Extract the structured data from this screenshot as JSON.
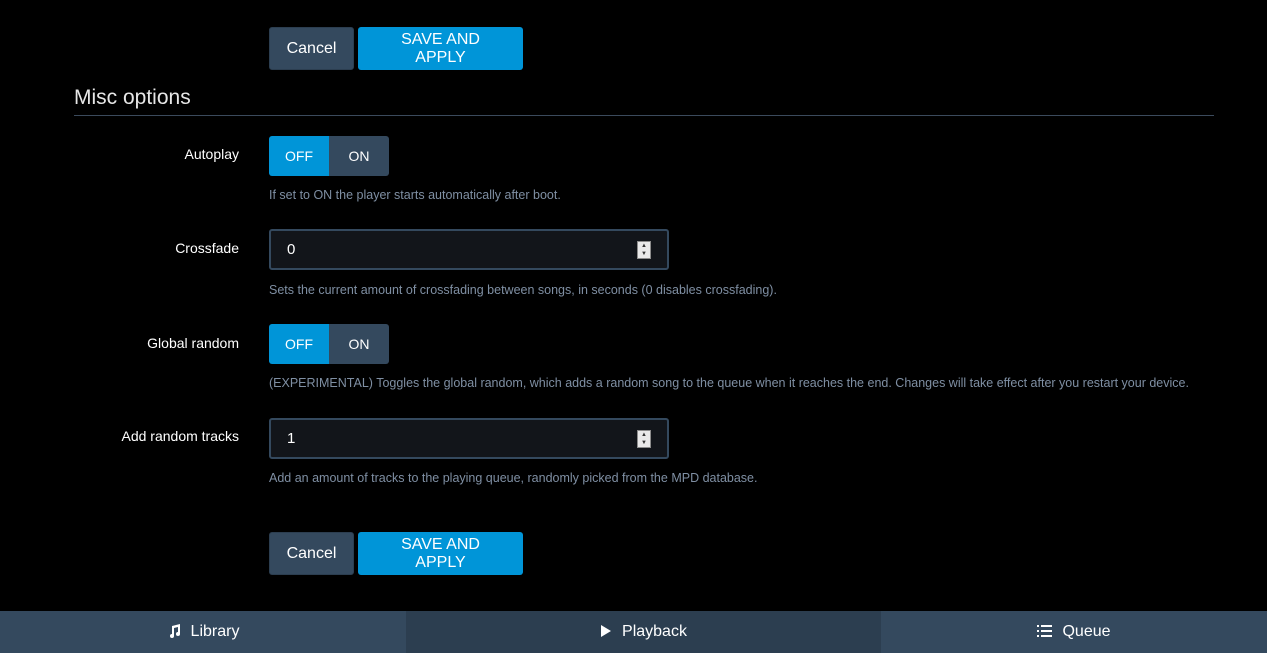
{
  "top_actions": {
    "cancel_label": "Cancel",
    "save_label": "SAVE AND APPLY"
  },
  "section": {
    "title": "Misc options"
  },
  "autoplay": {
    "label": "Autoplay",
    "off_label": "OFF",
    "on_label": "ON",
    "selected": "OFF",
    "help": "If set to ON the player starts automatically after boot."
  },
  "crossfade": {
    "label": "Crossfade",
    "value": "0",
    "help": "Sets the current amount of crossfading between songs, in seconds (0 disables crossfading)."
  },
  "global_random": {
    "label": "Global random",
    "off_label": "OFF",
    "on_label": "ON",
    "selected": "OFF",
    "help": "(EXPERIMENTAL) Toggles the global random, which adds a random song to the queue when it reaches the end. Changes will take effect after you restart your device."
  },
  "random_tracks": {
    "label": "Add random tracks",
    "value": "1",
    "help": "Add an amount of tracks to the playing queue, randomly picked from the MPD database."
  },
  "bottom_actions": {
    "cancel_label": "Cancel",
    "save_label": "SAVE AND APPLY"
  },
  "nav": {
    "library": {
      "label": "Library",
      "icon": "music-note-icon"
    },
    "playback": {
      "label": "Playback",
      "icon": "play-icon"
    },
    "queue": {
      "label": "Queue",
      "icon": "list-icon"
    }
  },
  "colors": {
    "accent": "#0095d8",
    "button_dark": "#34495e",
    "nav_active": "#2c3e50",
    "help_text": "#7f8fa3"
  }
}
